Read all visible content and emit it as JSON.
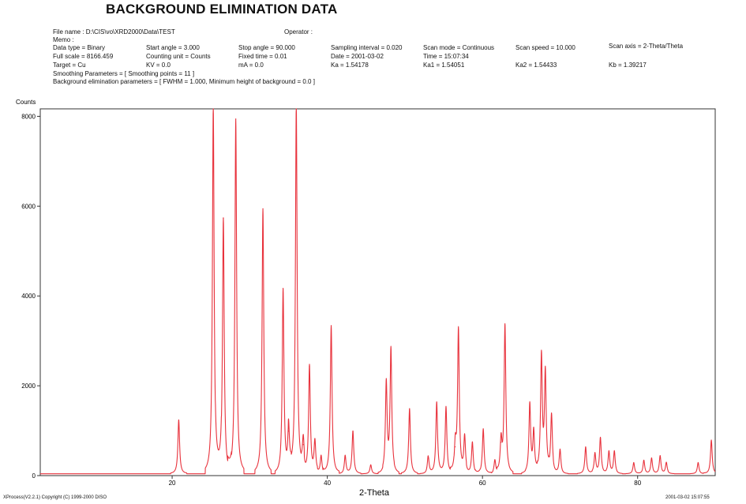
{
  "header": {
    "title": "BACKGROUND ELIMINATION DATA",
    "file_name": "File name : D:\\CIS\\vo\\XRD2000\\Data\\TEST",
    "operator": "Operator :",
    "memo": "Memo :",
    "params": [
      [
        "Data type = Binary",
        "Start angle = 3.000",
        "Stop angle = 90.000",
        "Sampling interval = 0.020",
        "Scan mode = Continuous",
        "Scan speed = 10.000",
        "Scan axis = 2-Theta/Theta"
      ],
      [
        "Full scale = 8166.459",
        "Counting unit = Counts",
        "Fixed time = 0.01",
        "Date = 2001-03-02",
        "Time = 15:07:34",
        "",
        ""
      ],
      [
        "Target = Cu",
        "KV = 0.0",
        "mA = 0.0",
        "Ka = 1.54178",
        "Ka1 = 1.54051",
        "Ka2 = 1.54433",
        "Kb = 1.39217"
      ]
    ],
    "smoothing": "Smoothing Parameters = [ Smoothing points = 11 ]",
    "background": "Background elimination parameters = [ FWHM = 1.000,  Minimum height of background = 0.0 ]"
  },
  "footer": {
    "left": "XProcess(V2.2.1)   Copyright (C) 1999-2000 DISO",
    "right": "2001-03-02  15:07:55"
  },
  "chart_data": {
    "type": "line",
    "ylabel": "Counts",
    "xlabel": "2-Theta",
    "xlim": [
      3,
      90
    ],
    "ylim": [
      0,
      8166.459
    ],
    "x_ticks": [
      20,
      40,
      60,
      80
    ],
    "y_ticks": [
      0,
      2000,
      4000,
      6000,
      8000
    ],
    "grid": false,
    "color": "#e8323c",
    "baseline": 40,
    "peaks": [
      {
        "x": 20.85,
        "y": 1200
      },
      {
        "x": 25.3,
        "y": 8200
      },
      {
        "x": 26.6,
        "y": 5700
      },
      {
        "x": 28.2,
        "y": 7900
      },
      {
        "x": 31.7,
        "y": 5900
      },
      {
        "x": 34.3,
        "y": 4100
      },
      {
        "x": 35.0,
        "y": 950
      },
      {
        "x": 36.0,
        "y": 8200
      },
      {
        "x": 36.9,
        "y": 650
      },
      {
        "x": 37.7,
        "y": 2400
      },
      {
        "x": 38.4,
        "y": 700
      },
      {
        "x": 39.2,
        "y": 400
      },
      {
        "x": 40.5,
        "y": 3300
      },
      {
        "x": 42.3,
        "y": 400
      },
      {
        "x": 43.3,
        "y": 950
      },
      {
        "x": 45.6,
        "y": 200
      },
      {
        "x": 47.6,
        "y": 2000
      },
      {
        "x": 48.2,
        "y": 2750
      },
      {
        "x": 50.6,
        "y": 1450
      },
      {
        "x": 53.0,
        "y": 400
      },
      {
        "x": 54.1,
        "y": 1600
      },
      {
        "x": 55.3,
        "y": 1500
      },
      {
        "x": 56.5,
        "y": 600
      },
      {
        "x": 56.9,
        "y": 3200
      },
      {
        "x": 57.7,
        "y": 800
      },
      {
        "x": 58.7,
        "y": 700
      },
      {
        "x": 60.1,
        "y": 1000
      },
      {
        "x": 61.6,
        "y": 300
      },
      {
        "x": 62.4,
        "y": 700
      },
      {
        "x": 62.9,
        "y": 3300
      },
      {
        "x": 66.1,
        "y": 1550
      },
      {
        "x": 66.6,
        "y": 900
      },
      {
        "x": 67.6,
        "y": 2600
      },
      {
        "x": 68.1,
        "y": 2200
      },
      {
        "x": 68.9,
        "y": 1300
      },
      {
        "x": 70.0,
        "y": 550
      },
      {
        "x": 73.3,
        "y": 600
      },
      {
        "x": 74.5,
        "y": 450
      },
      {
        "x": 75.2,
        "y": 800
      },
      {
        "x": 76.3,
        "y": 500
      },
      {
        "x": 77.0,
        "y": 500
      },
      {
        "x": 79.5,
        "y": 250
      },
      {
        "x": 80.8,
        "y": 300
      },
      {
        "x": 81.8,
        "y": 350
      },
      {
        "x": 82.9,
        "y": 400
      },
      {
        "x": 83.7,
        "y": 250
      },
      {
        "x": 87.8,
        "y": 250
      },
      {
        "x": 89.5,
        "y": 750
      }
    ]
  }
}
